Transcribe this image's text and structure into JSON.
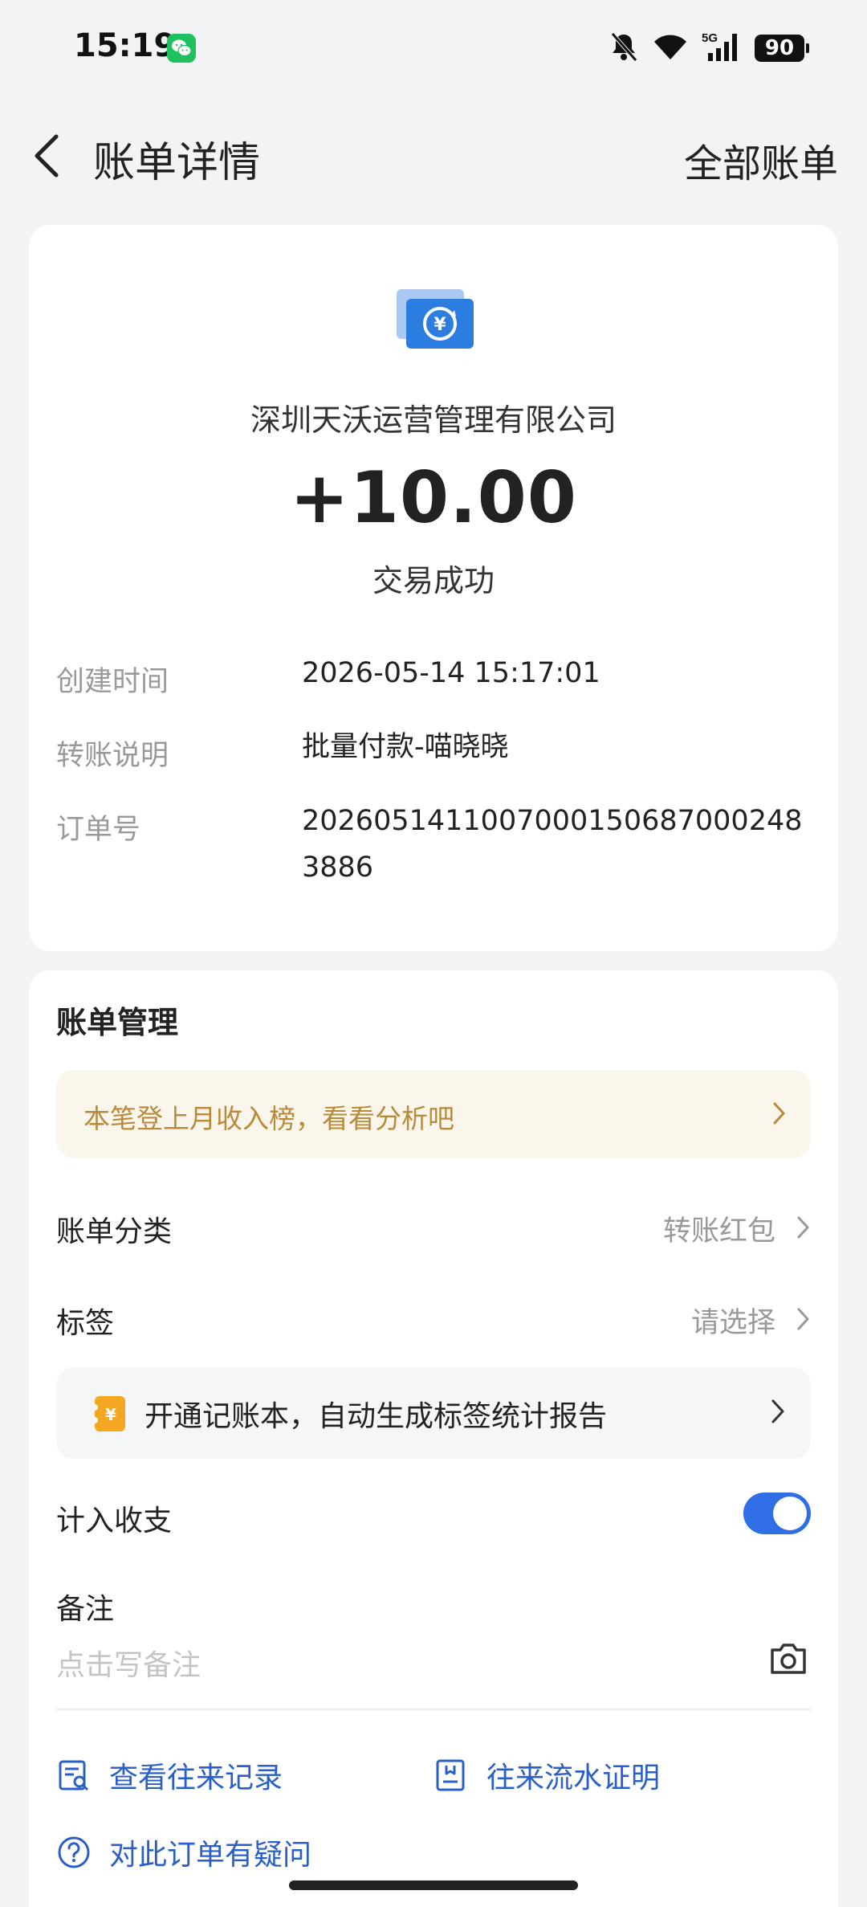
{
  "status_bar": {
    "time": "15:19",
    "battery": "90",
    "network": "5G",
    "icons": [
      "wechat-icon",
      "mute-bell-icon",
      "wifi-icon",
      "signal-icon",
      "battery-icon"
    ]
  },
  "nav": {
    "title": "账单详情",
    "action": "全部账单"
  },
  "summary": {
    "merchant": "深圳天沃运营管理有限公司",
    "amount": "+10.00",
    "status": "交易成功",
    "icon": "transfer-yuan-icon"
  },
  "details": [
    {
      "label": "创建时间",
      "value": "2026-05-14 15:17:01"
    },
    {
      "label": "转账说明",
      "value": "批量付款-喵晓晓"
    },
    {
      "label": "订单号",
      "value": "20260514110070001506870002483886"
    }
  ],
  "management": {
    "title": "账单管理",
    "promo": "本笔登上月收入榜，看看分析吧",
    "category_label": "账单分类",
    "category_value": "转账红包",
    "tag_label": "标签",
    "tag_value": "请选择",
    "ledger_promo": "开通记账本，自动生成标签统计报告",
    "include_label": "计入收支",
    "include_enabled": true,
    "note_label": "备注",
    "note_placeholder": "点击写备注"
  },
  "links": {
    "history": "查看往来记录",
    "proof": "往来流水证明",
    "question": "对此订单有疑问"
  },
  "colors": {
    "accent": "#2f6ee5",
    "link": "#2a5fc8",
    "promo_text": "#b88a3a",
    "promo_bg": "#fbf6ec",
    "background": "#f2f3f5"
  }
}
